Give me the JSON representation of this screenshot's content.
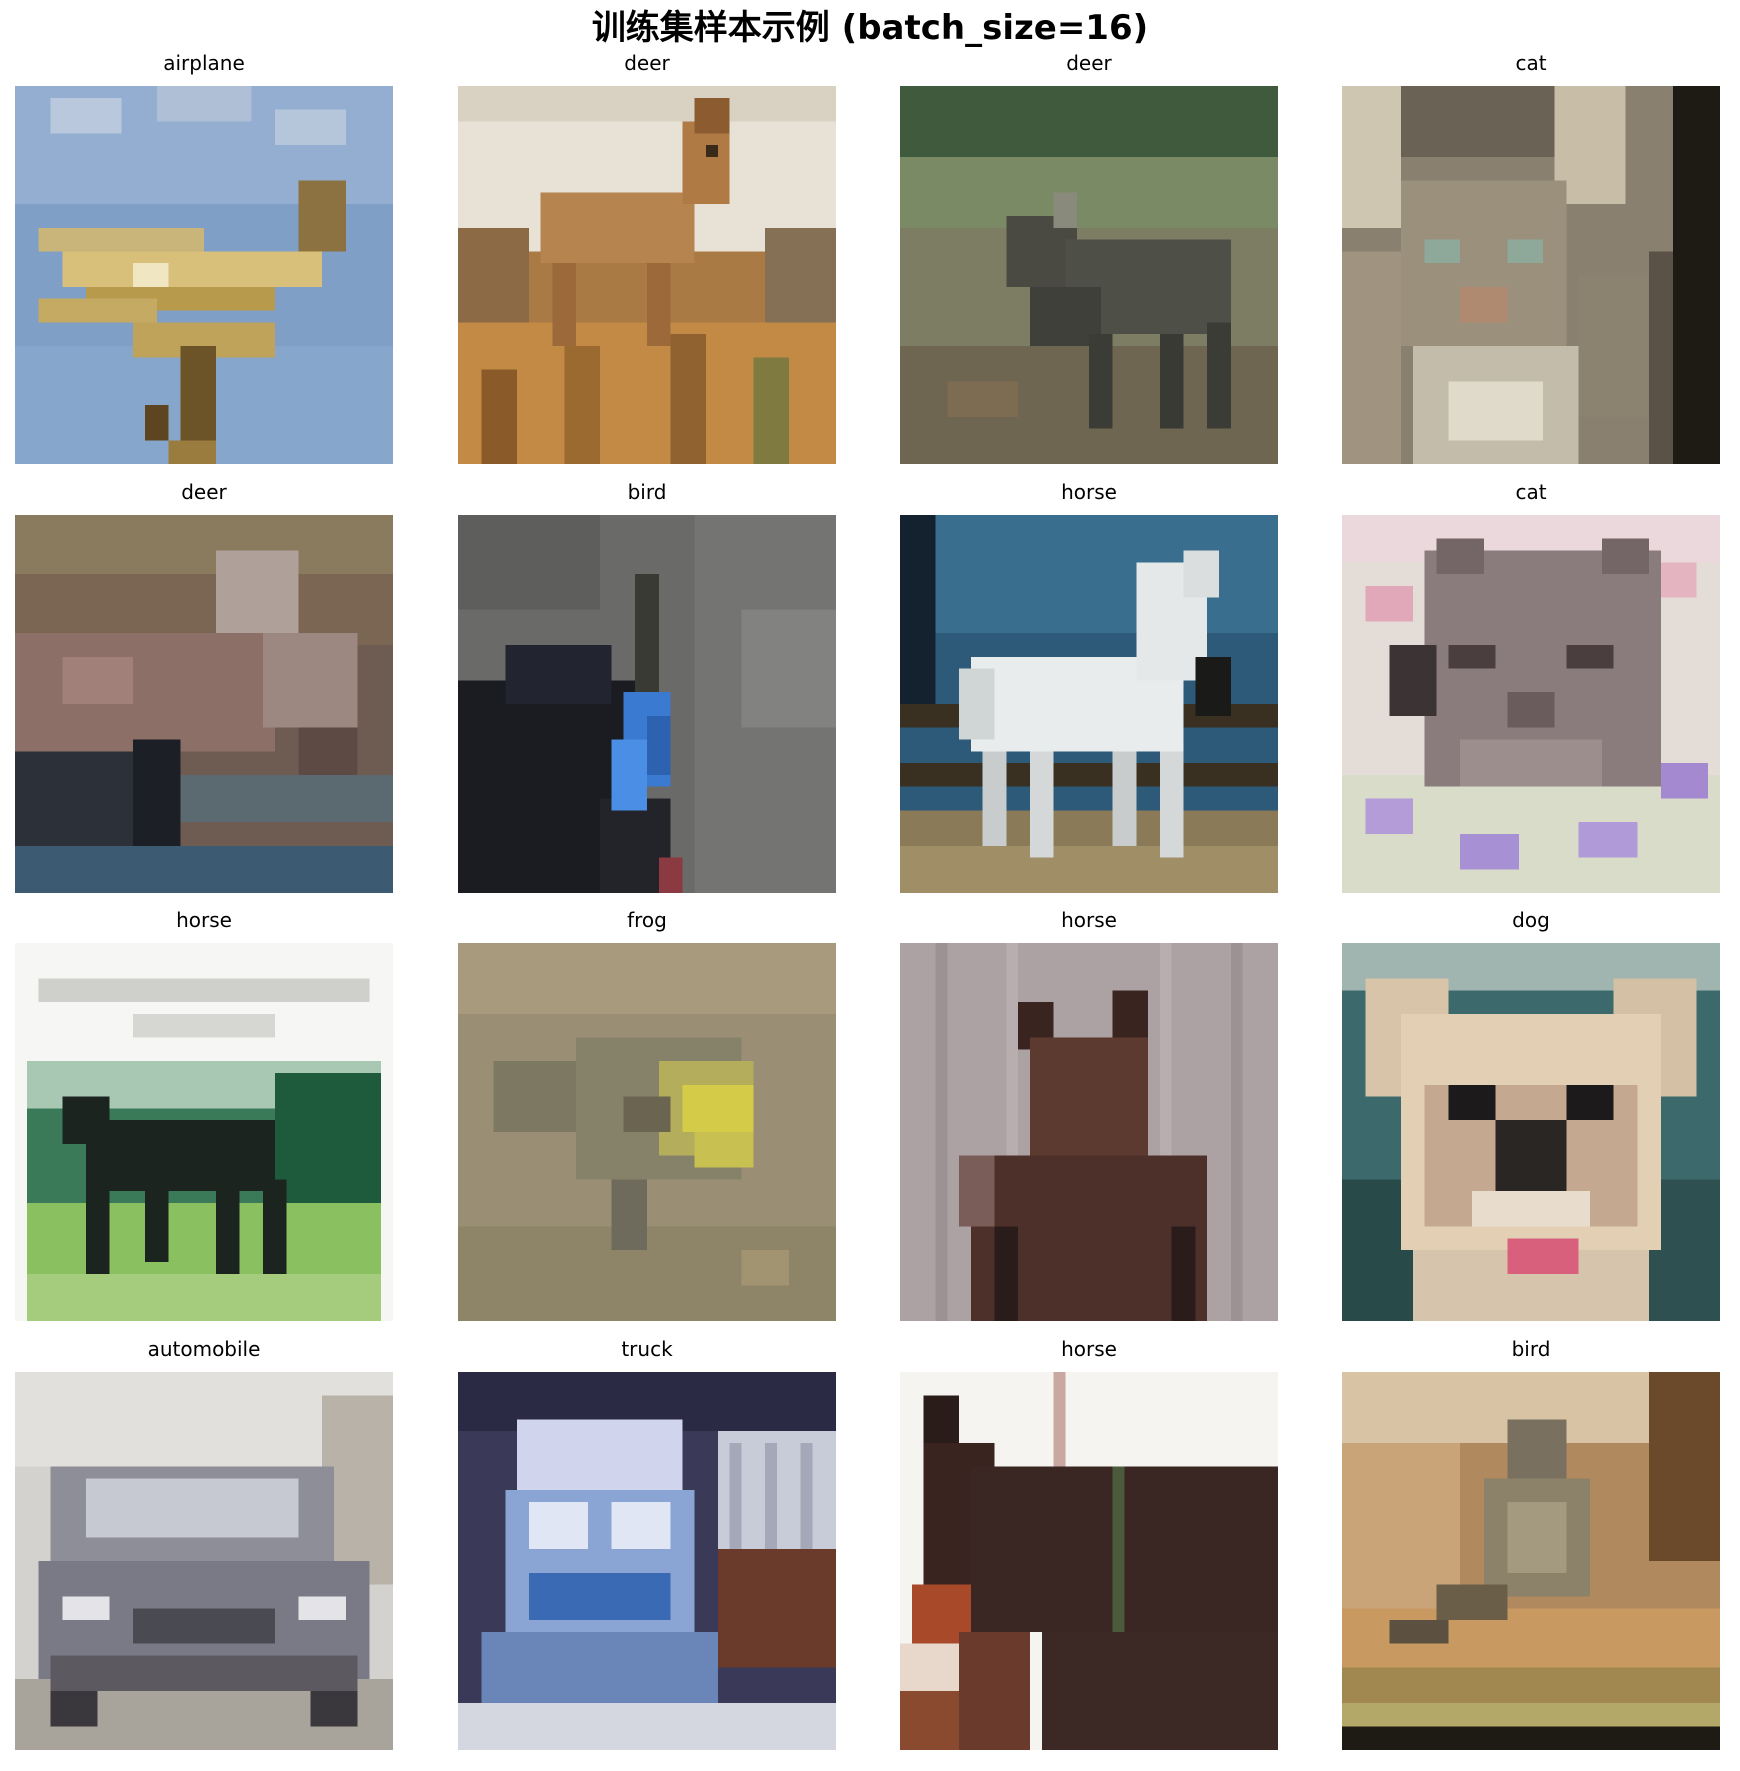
{
  "figure": {
    "title": "训练集样本示例 (batch_size=16)"
  },
  "samples": [
    {
      "label": "airplane",
      "scene": "airplane"
    },
    {
      "label": "deer",
      "scene": "deer-standing"
    },
    {
      "label": "deer",
      "scene": "deer-grass"
    },
    {
      "label": "cat",
      "scene": "cat-tabby"
    },
    {
      "label": "deer",
      "scene": "deer-moose"
    },
    {
      "label": "bird",
      "scene": "bird-blue"
    },
    {
      "label": "horse",
      "scene": "horse-white"
    },
    {
      "label": "cat",
      "scene": "cat-flowers"
    },
    {
      "label": "horse",
      "scene": "horse-black-running"
    },
    {
      "label": "frog",
      "scene": "frog"
    },
    {
      "label": "horse",
      "scene": "horse-brown-front"
    },
    {
      "label": "dog",
      "scene": "dog-chihuahua"
    },
    {
      "label": "automobile",
      "scene": "car"
    },
    {
      "label": "truck",
      "scene": "truck"
    },
    {
      "label": "horse",
      "scene": "horse-dark-side"
    },
    {
      "label": "bird",
      "scene": "bird-perched"
    }
  ]
}
